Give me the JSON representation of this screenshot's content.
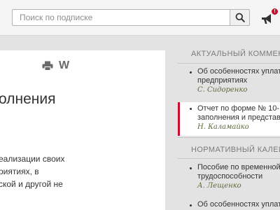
{
  "search": {
    "placeholder": "Поиск по подписке",
    "value": ""
  },
  "colors": {
    "accent": "#c8102e",
    "author": "#5b6b3a",
    "background": "#e3e3e3"
  },
  "icons": {
    "search": "search-icon",
    "notify": "megaphone-icon",
    "print": "printer-icon",
    "word": "word-icon"
  },
  "notifications": {
    "badge": "!"
  },
  "toolbar": {
    "word_label": "W"
  },
  "document": {
    "title": "олнения",
    "body": [
      "еализации своих",
      "риятиях, в",
      "ской и другой не"
    ]
  },
  "sidebar": {
    "sections": [
      {
        "title": "АКТУАЛЬНЫЙ КОММЕНТ",
        "items": [
          {
            "lines": [
              "Об особенностях уплаты",
              "предприятиях"
            ],
            "author": "С. Сидоренко",
            "active": false
          },
          {
            "lines": [
              "Отчет по форме № 10-П",
              "заполнения и представл"
            ],
            "author": "Н. Каламайко",
            "active": true
          }
        ]
      },
      {
        "title": "НОРМАТИВНЫЙ КАЛЕЙ",
        "items": [
          {
            "lines": [
              "Пособие по временной",
              "трудоспособности"
            ],
            "author": "А. Лещенко",
            "active": false
          },
          {
            "lines": [
              "Об особенностях уплат"
            ],
            "author": "",
            "active": false
          }
        ]
      }
    ]
  }
}
